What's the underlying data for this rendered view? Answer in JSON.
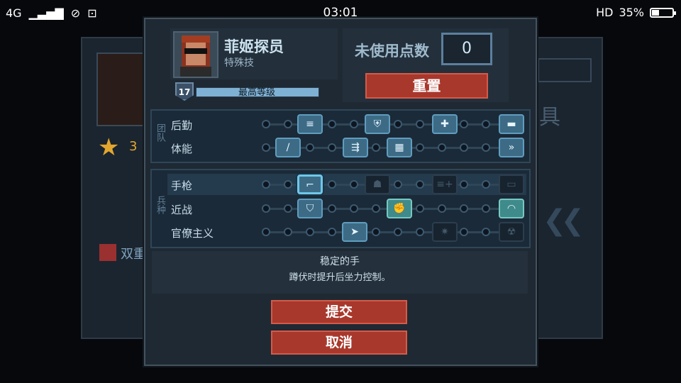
{
  "status_bar": {
    "network": "4G",
    "time": "03:01",
    "hd": "HD",
    "battery": "35%",
    "battery_level": 0.35
  },
  "background": {
    "star_count": "3",
    "partial_text": "双重",
    "partial_right_char": "具"
  },
  "character": {
    "name": "菲姬探员",
    "class": "特殊技",
    "level": "17",
    "level_label": "最高等级",
    "xp_fraction": 1.0
  },
  "points": {
    "label": "未使用点数",
    "value": "0",
    "reset_label": "重置"
  },
  "sections": {
    "team": {
      "label": "团队",
      "rows": [
        {
          "label": "后勤",
          "nodes": [
            {
              "icon": "ammo-belt-icon",
              "glyph": "≡",
              "active": true
            },
            {
              "icon": "shield-plus-icon",
              "glyph": "⛨",
              "active": true
            },
            {
              "icon": "medkit-icon",
              "glyph": "✚",
              "active": true
            },
            {
              "icon": "bed-icon",
              "glyph": "▬",
              "active": true
            }
          ]
        },
        {
          "label": "体能",
          "nodes": [
            {
              "icon": "knife-icon",
              "glyph": "∕",
              "active": true
            },
            {
              "icon": "boot-icon",
              "glyph": "⇶",
              "active": true
            },
            {
              "icon": "crate-icon",
              "glyph": "▦",
              "active": true
            },
            {
              "icon": "sprint-icon",
              "glyph": "»",
              "active": true
            }
          ]
        }
      ]
    },
    "weapon": {
      "label": "兵种",
      "rows": [
        {
          "label": "手枪",
          "nodes": [
            {
              "icon": "pistol-aim-icon",
              "glyph": "⌐",
              "active": true,
              "selected": true
            },
            {
              "icon": "soldier-icon",
              "glyph": "☗",
              "active": false
            },
            {
              "icon": "mag-plus-icon",
              "glyph": "≡+",
              "active": false
            },
            {
              "icon": "bullet-icon",
              "glyph": "▭",
              "active": false
            }
          ]
        },
        {
          "label": "近战",
          "nodes": [
            {
              "icon": "shield-icon",
              "glyph": "⛉",
              "active": true
            },
            {
              "icon": "knuckles-icon",
              "glyph": "✊",
              "active": true
            },
            {
              "icon": "helmet-icon",
              "glyph": "◠",
              "active": true
            }
          ]
        },
        {
          "label": "官僚主义",
          "nodes": [
            {
              "icon": "arrow-tag-icon",
              "glyph": "➤",
              "active": true
            },
            {
              "icon": "gear-icon",
              "glyph": "✷",
              "active": false
            },
            {
              "icon": "gas-mask-icon",
              "glyph": "☢",
              "active": false
            }
          ]
        }
      ]
    }
  },
  "description": {
    "title": "稳定的手",
    "text": "蹲伏时提升后坐力控制。"
  },
  "buttons": {
    "submit": "提交",
    "cancel": "取消"
  },
  "colors": {
    "accent_red": "#a8382c",
    "node_active": "#3d6b86",
    "node_teal": "#3f8a8a",
    "star": "#e3a72f"
  }
}
